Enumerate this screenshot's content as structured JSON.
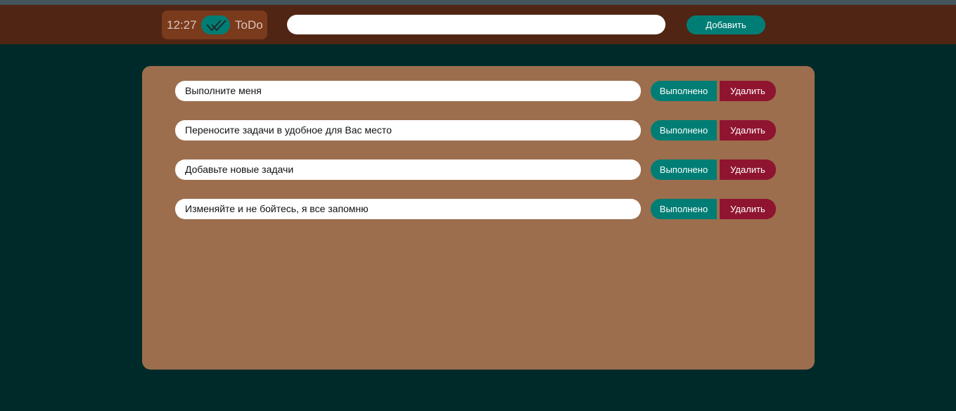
{
  "header": {
    "time": "12:27",
    "app_name": "ToDo",
    "check_icon": "double-check-icon",
    "input_value": "",
    "input_placeholder": "",
    "add_label": "Добавить"
  },
  "colors": {
    "header_bg": "#512514",
    "page_bg": "#002a29",
    "panel_bg": "#9c6e4d",
    "accent": "#007e75",
    "danger": "#8f1430"
  },
  "tasks": [
    {
      "text": "Выполните меня",
      "done_label": "Выполнено",
      "delete_label": "Удалить"
    },
    {
      "text": "Переносите задачи в удобное для Вас место",
      "done_label": "Выполнено",
      "delete_label": "Удалить"
    },
    {
      "text": "Добавьте новые задачи",
      "done_label": "Выполнено",
      "delete_label": "Удалить"
    },
    {
      "text": "Изменяйте и не бойтесь, я все запомню",
      "done_label": "Выполнено",
      "delete_label": "Удалить"
    }
  ]
}
